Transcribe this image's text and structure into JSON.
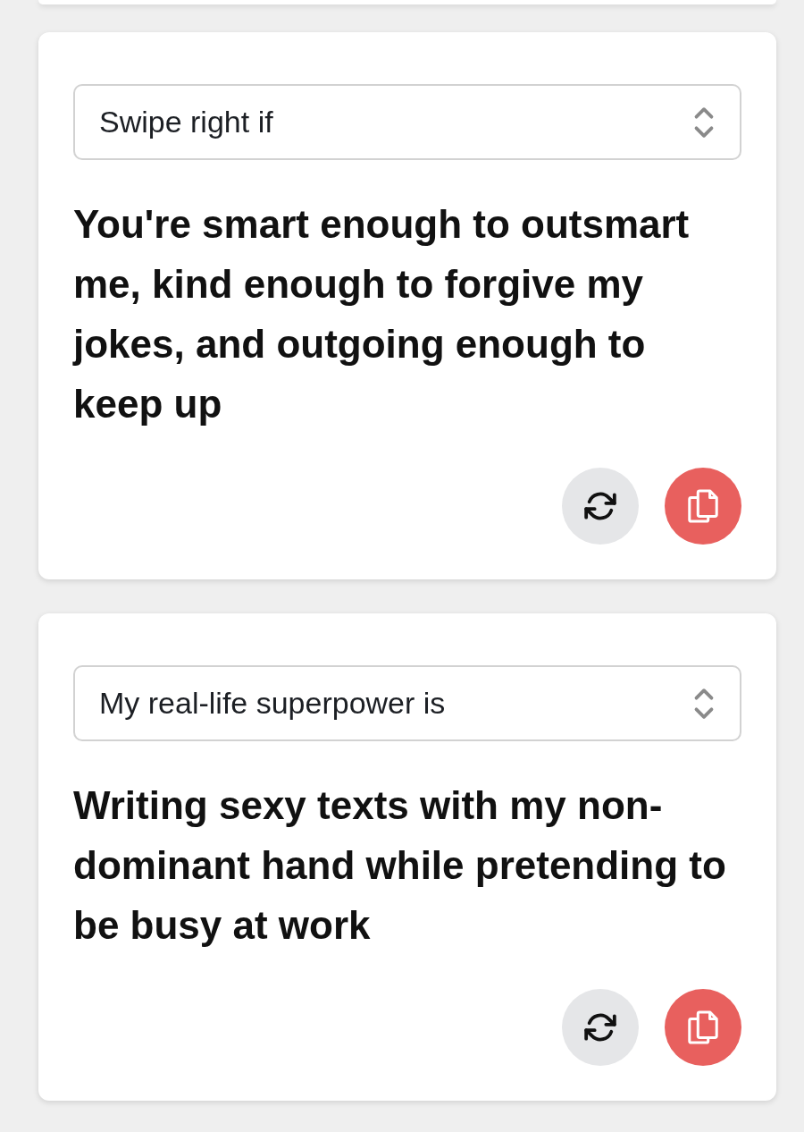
{
  "cards": [
    {
      "prompt": "Swipe right if",
      "answer": "You're smart enough to outsmart me, kind enough to forgive my jokes, and outgoing enough to keep up"
    },
    {
      "prompt": "My real-life superpower is",
      "answer": "Writing sexy texts with my non-dominant hand while pretending to be busy at work"
    }
  ]
}
